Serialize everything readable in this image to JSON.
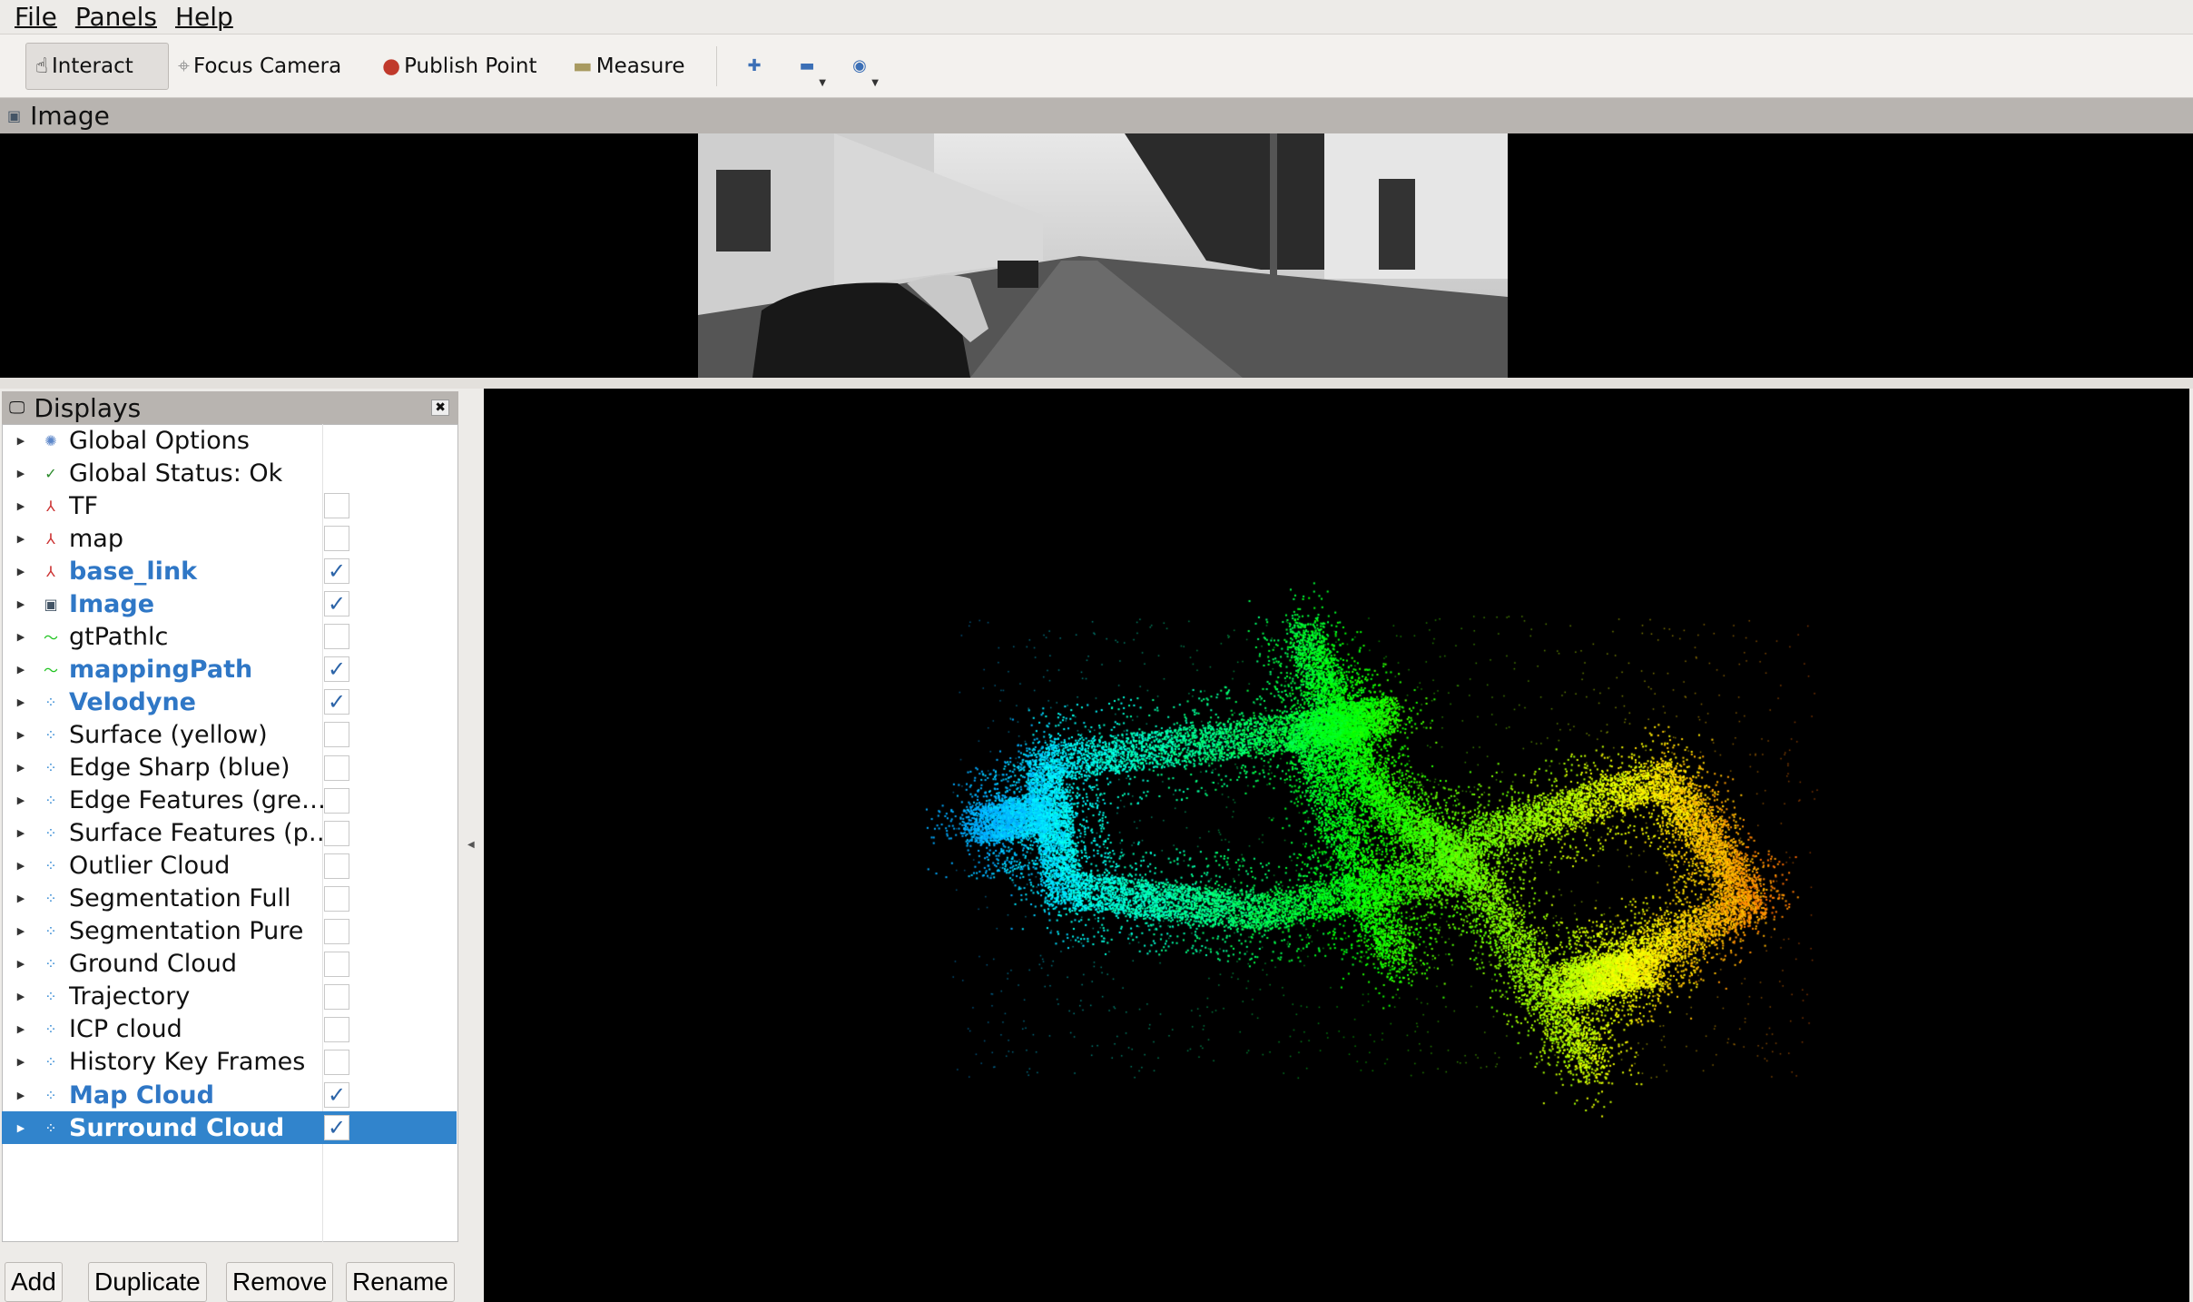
{
  "menu": [
    "File",
    "Panels",
    "Help"
  ],
  "toolbar": {
    "interact": "Interact",
    "focus_camera": "Focus Camera",
    "publish_point": "Publish Point",
    "measure": "Measure"
  },
  "image_panel": {
    "title": "Image"
  },
  "displays": {
    "title": "Displays",
    "items": [
      {
        "label": "Global Options",
        "icon": "gear-icon",
        "checkbox": null,
        "on": false
      },
      {
        "label": "Global Status: Ok",
        "icon": "check-icon",
        "checkbox": null,
        "on": false
      },
      {
        "label": "TF",
        "icon": "axes-icon",
        "checkbox": false,
        "on": false
      },
      {
        "label": "map",
        "icon": "axes-icon",
        "checkbox": false,
        "on": false
      },
      {
        "label": "base_link",
        "icon": "axes-icon",
        "checkbox": true,
        "on": true
      },
      {
        "label": "Image",
        "icon": "image-icon",
        "checkbox": true,
        "on": true
      },
      {
        "label": "gtPathlc",
        "icon": "path-icon",
        "checkbox": false,
        "on": false
      },
      {
        "label": "mappingPath",
        "icon": "path-icon",
        "checkbox": true,
        "on": true
      },
      {
        "label": "Velodyne",
        "icon": "pointcloud-icon",
        "checkbox": true,
        "on": true
      },
      {
        "label": "Surface (yellow)",
        "icon": "pointcloud-icon",
        "checkbox": false,
        "on": false
      },
      {
        "label": "Edge Sharp (blue)",
        "icon": "pointcloud-icon",
        "checkbox": false,
        "on": false
      },
      {
        "label": "Edge Features (gre…",
        "icon": "pointcloud-icon",
        "checkbox": false,
        "on": false
      },
      {
        "label": "Surface Features (p…",
        "icon": "pointcloud-icon",
        "checkbox": false,
        "on": false
      },
      {
        "label": "Outlier Cloud",
        "icon": "pointcloud-icon",
        "checkbox": false,
        "on": false
      },
      {
        "label": "Segmentation Full",
        "icon": "pointcloud-icon",
        "checkbox": false,
        "on": false
      },
      {
        "label": "Segmentation Pure",
        "icon": "pointcloud-icon",
        "checkbox": false,
        "on": false
      },
      {
        "label": "Ground Cloud",
        "icon": "pointcloud-icon",
        "checkbox": false,
        "on": false
      },
      {
        "label": "Trajectory",
        "icon": "pointcloud-icon",
        "checkbox": false,
        "on": false
      },
      {
        "label": "ICP cloud",
        "icon": "pointcloud-icon",
        "checkbox": false,
        "on": false
      },
      {
        "label": "History Key Frames",
        "icon": "pointcloud-icon",
        "checkbox": false,
        "on": false
      },
      {
        "label": "Map Cloud",
        "icon": "pointcloud-icon",
        "checkbox": true,
        "on": true
      },
      {
        "label": "Surround Cloud",
        "icon": "pointcloud-icon",
        "checkbox": true,
        "on": true,
        "selected": true
      }
    ]
  },
  "buttons": {
    "add": "Add",
    "duplicate": "Duplicate",
    "remove": "Remove",
    "rename": "Rename"
  },
  "colors": {
    "selection": "#3184cc",
    "enabled_text": "#2f77c6"
  }
}
